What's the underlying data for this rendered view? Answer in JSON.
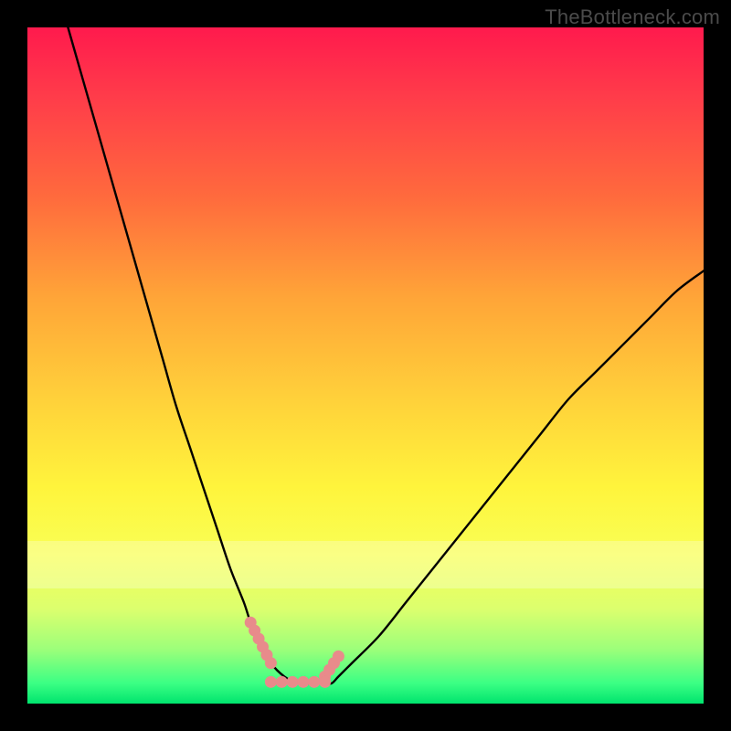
{
  "watermark": {
    "text": "TheBottleneck.com"
  },
  "chart_data": {
    "type": "line",
    "title": "",
    "xlabel": "",
    "ylabel": "",
    "xlim": [
      0,
      100
    ],
    "ylim": [
      0,
      100
    ],
    "series": [
      {
        "name": "bottleneck-curve",
        "x": [
          6,
          8,
          10,
          12,
          14,
          16,
          18,
          20,
          22,
          24,
          26,
          28,
          30,
          32,
          33,
          34,
          35,
          36,
          38,
          40,
          42,
          43,
          44,
          45,
          46,
          48,
          52,
          56,
          60,
          64,
          68,
          72,
          76,
          80,
          84,
          88,
          92,
          96,
          100
        ],
        "values": [
          100,
          93,
          86,
          79,
          72,
          65,
          58,
          51,
          44,
          38,
          32,
          26,
          20,
          15,
          12,
          10,
          8,
          6,
          4,
          3,
          3,
          3,
          3,
          3,
          4,
          6,
          10,
          15,
          20,
          25,
          30,
          35,
          40,
          45,
          49,
          53,
          57,
          61,
          64
        ]
      }
    ],
    "annotations": [
      {
        "name": "dotted-left",
        "shape": "dotted-segment",
        "x": [
          33,
          36
        ],
        "y": [
          12,
          6
        ],
        "color": "#e88b8b"
      },
      {
        "name": "dotted-right",
        "shape": "dotted-segment",
        "x": [
          44,
          46
        ],
        "y": [
          4,
          7
        ],
        "color": "#e88b8b"
      },
      {
        "name": "dotted-bottom",
        "shape": "dotted-segment",
        "x": [
          36,
          44
        ],
        "y": [
          3.2,
          3.2
        ],
        "color": "#e88b8b"
      }
    ],
    "background_gradient": [
      "#ff1a4d",
      "#ffd13a",
      "#f8ff55",
      "#00e46e"
    ],
    "grid": false
  }
}
